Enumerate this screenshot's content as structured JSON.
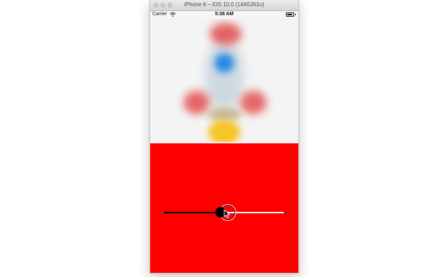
{
  "window": {
    "title": "iPhone 6 – iOS 10.0 (14A5261u)"
  },
  "status_bar": {
    "carrier": "Carrier",
    "time": "5:38 AM",
    "icons": [
      "wifi-icon",
      "battery-icon"
    ]
  },
  "image": {
    "description_icon": "blurred-rocket-image"
  },
  "slider": {
    "value": 0.47,
    "min_track_color": "#000000",
    "max_track_color": "#ffffff",
    "thumb_color": "#000000"
  },
  "colors": {
    "control_background": "#ff0000",
    "image_background": "#f4f4f4"
  }
}
